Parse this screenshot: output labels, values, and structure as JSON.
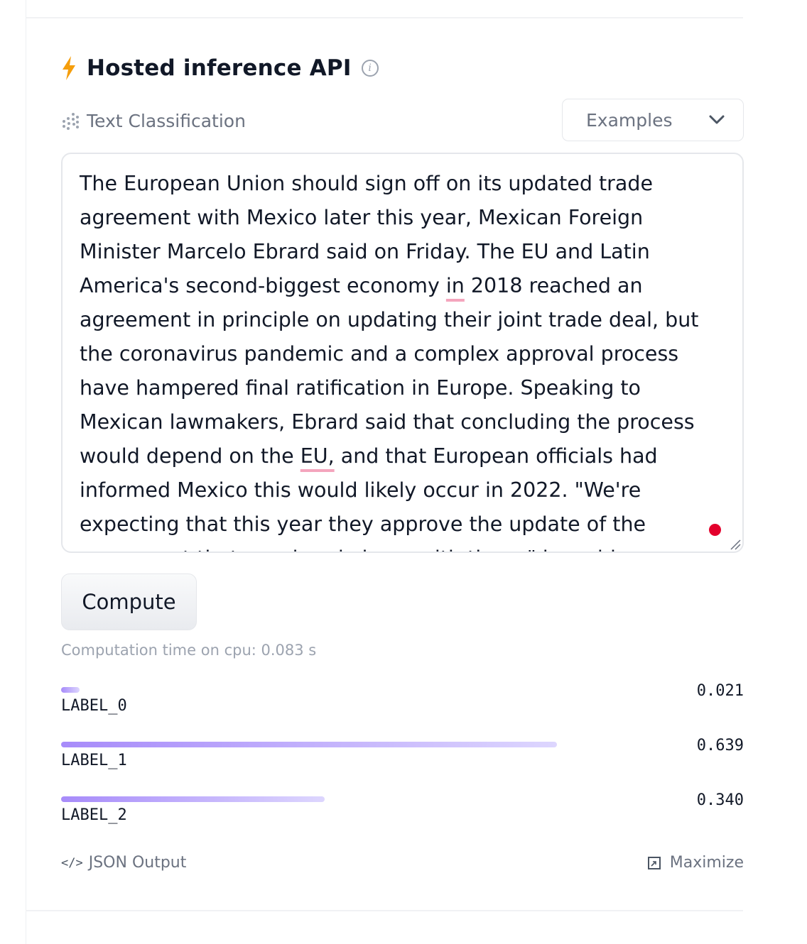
{
  "widget": {
    "title": "Hosted inference API",
    "task_label": "Text Classification",
    "examples_label": "Examples"
  },
  "input": {
    "text_before_1": "The European Union should sign off on its updated trade agreement with Mexico later this year, Mexican Foreign Minister Marcelo Ebrard said on Friday. The EU and Latin America's second-biggest economy ",
    "squiggle_1": "in",
    "text_between": " 2018 reached an agreement in principle on updating their joint trade deal, but the coronavirus pandemic and a complex approval process have hampered final ratification in Europe. Speaking to Mexican lawmakers, Ebrard said that concluding the process would depend on the ",
    "squiggle_2": "EU,",
    "text_after": " and that European officials had informed Mexico this would likely occur in 2022. \"We're expecting that this year they approve the update of the agreement that we already have with them,\" he said."
  },
  "actions": {
    "compute_label": "Compute",
    "computation_time": "Computation time on cpu: 0.083 s"
  },
  "results": [
    {
      "label": "LABEL_0",
      "score_text": "0.021",
      "score": 0.021
    },
    {
      "label": "LABEL_1",
      "score_text": "0.639",
      "score": 0.639
    },
    {
      "label": "LABEL_2",
      "score_text": "0.340",
      "score": 0.34
    }
  ],
  "footer": {
    "json_output_label": "JSON Output",
    "json_icon": "</>",
    "maximize_label": "Maximize"
  },
  "colors": {
    "bolt": "#f59e0b",
    "bar_start": "#a78bfa",
    "bar_end": "#ddd6fe",
    "record_dot": "#e3002c"
  }
}
